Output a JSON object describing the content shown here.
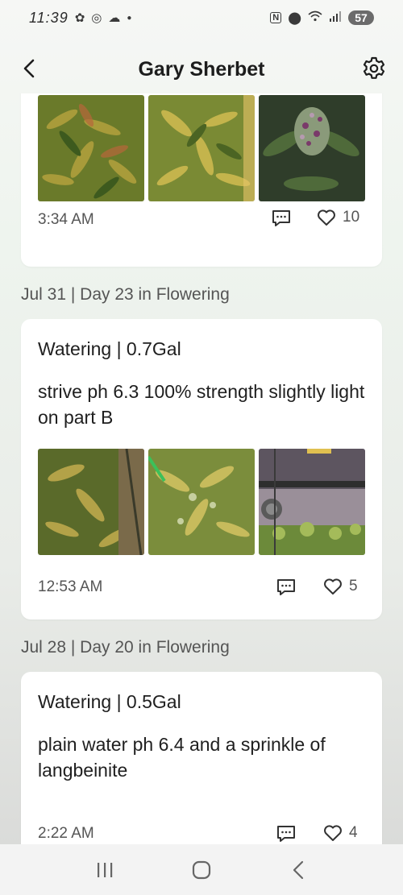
{
  "status_bar": {
    "time": "11:39",
    "battery": "57",
    "left_icons": [
      "cannabis-leaf-icon",
      "target-icon",
      "cloud-icon",
      "dot-icon"
    ],
    "right_icons": [
      "nfc-icon",
      "location-icon",
      "wifi-icon",
      "signal-icon"
    ]
  },
  "header": {
    "title": "Gary Sherbet",
    "back_icon": "chevron-left-icon",
    "settings_icon": "gear-icon"
  },
  "entries": [
    {
      "date_label": "",
      "title": "",
      "text": "",
      "photos": [
        "plant-photo-1",
        "plant-photo-2",
        "plant-photo-3"
      ],
      "time": "3:34 AM",
      "likes": "10"
    },
    {
      "date_label": "Jul 31 | Day 23 in Flowering",
      "title": "Watering | 0.7Gal",
      "text": "strive ph 6.3 100% strength slightly light on part B",
      "photos": [
        "plant-photo-4",
        "plant-photo-5",
        "grow-tent-photo"
      ],
      "time": "12:53 AM",
      "likes": "5"
    },
    {
      "date_label": "Jul 28 | Day 20 in Flowering",
      "title": "Watering | 0.5Gal",
      "text": "plain water ph 6.4 and a sprinkle of langbeinite",
      "photos": [],
      "time": "2:22 AM",
      "likes": "4"
    }
  ],
  "nav_bar": {
    "recent_icon": "recent-apps-icon",
    "home_icon": "home-icon",
    "back_icon": "back-icon"
  },
  "colors": {
    "accent_text": "#1d1d1d",
    "muted_text": "#555555",
    "card_bg": "#ffffff"
  }
}
